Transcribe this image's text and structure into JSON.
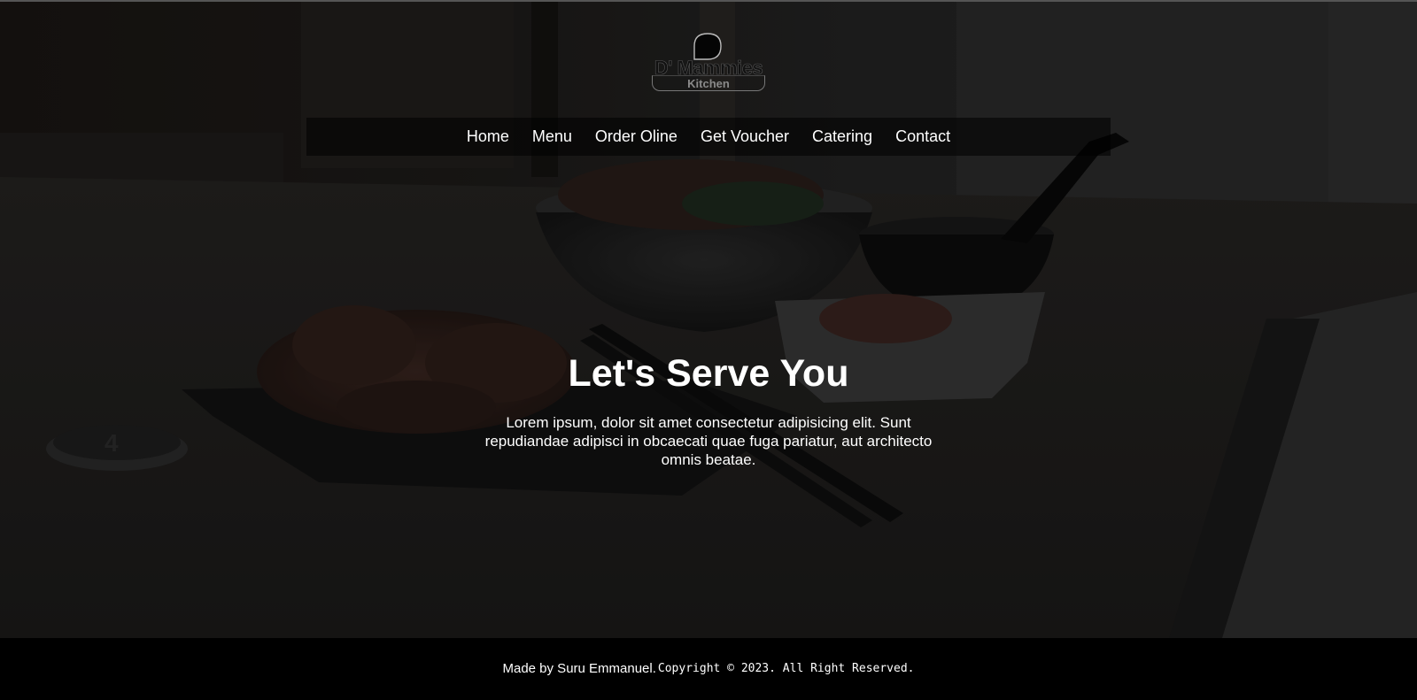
{
  "brand": {
    "name": "D' Mammies",
    "sub": "Kitchen"
  },
  "nav": {
    "items": [
      {
        "label": "Home"
      },
      {
        "label": "Menu"
      },
      {
        "label": "Order Oline"
      },
      {
        "label": "Get Voucher"
      },
      {
        "label": "Catering"
      },
      {
        "label": "Contact"
      }
    ]
  },
  "hero": {
    "title": "Let's Serve You",
    "text": "Lorem ipsum, dolor sit amet consectetur adipisicing elit. Sunt repudiandae adipisci in obcaecati quae fuga pariatur, aut architecto omnis beatae."
  },
  "footer": {
    "author": "Made by Suru Emmanuel.",
    "copyright": "Copyright © 2023. All Right Reserved."
  },
  "colors": {
    "overlay": "#000000",
    "text": "#ffffff",
    "footer_bg": "#000000"
  }
}
